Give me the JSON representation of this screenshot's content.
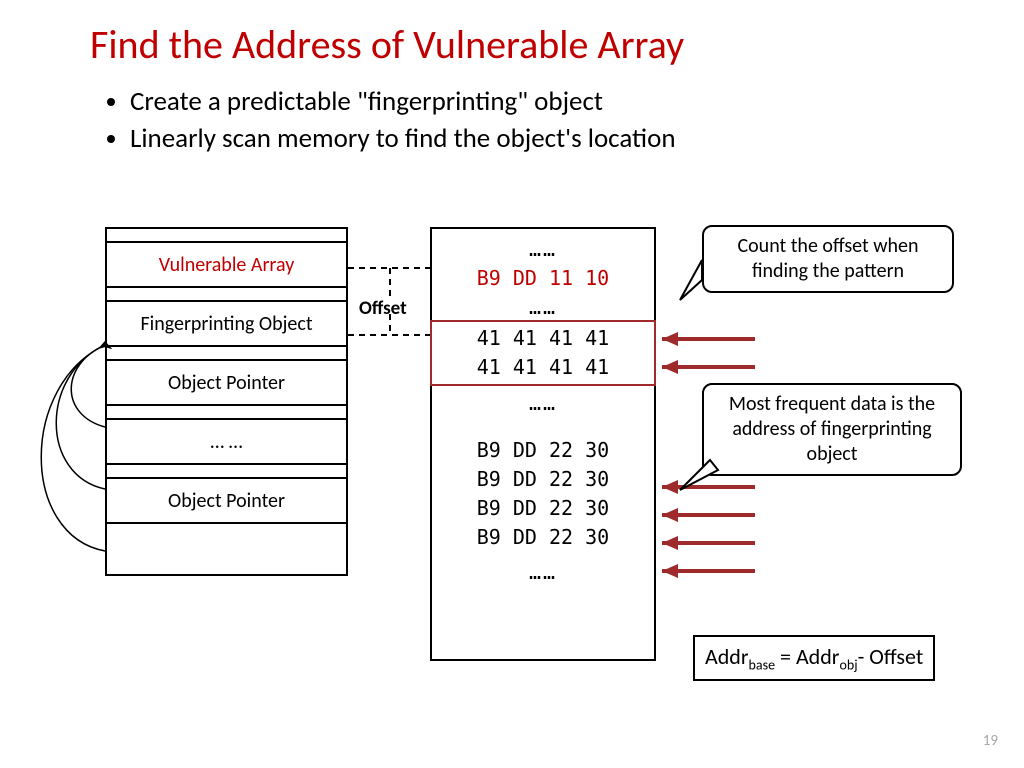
{
  "title": "Find the Address of Vulnerable Array",
  "bullets": [
    "Create a predictable \"fingerprinting\" object",
    "Linearly scan memory to find the object's location"
  ],
  "stack": {
    "vulnerable": "Vulnerable Array",
    "fingerprinting": "Fingerprinting Object",
    "pointer1": "Object Pointer",
    "ellipsis": "… …",
    "pointer2": "Object Pointer"
  },
  "offset_label": "Offset",
  "memory": {
    "dots": "……",
    "vuln_bytes": "B9 DD 11 10",
    "pattern1": "41 41 41 41",
    "pattern2": "41 41 41 41",
    "ptr_bytes": "B9 DD 22 30"
  },
  "callouts": {
    "c1": "Count the offset when finding the pattern",
    "c2": "Most frequent data is the address of fingerprinting object"
  },
  "formula": {
    "prefix": "Addr",
    "sub1": "base",
    "eq": " = Addr",
    "sub2": "obj",
    "suffix": "- Offset"
  },
  "slide_number": "19"
}
